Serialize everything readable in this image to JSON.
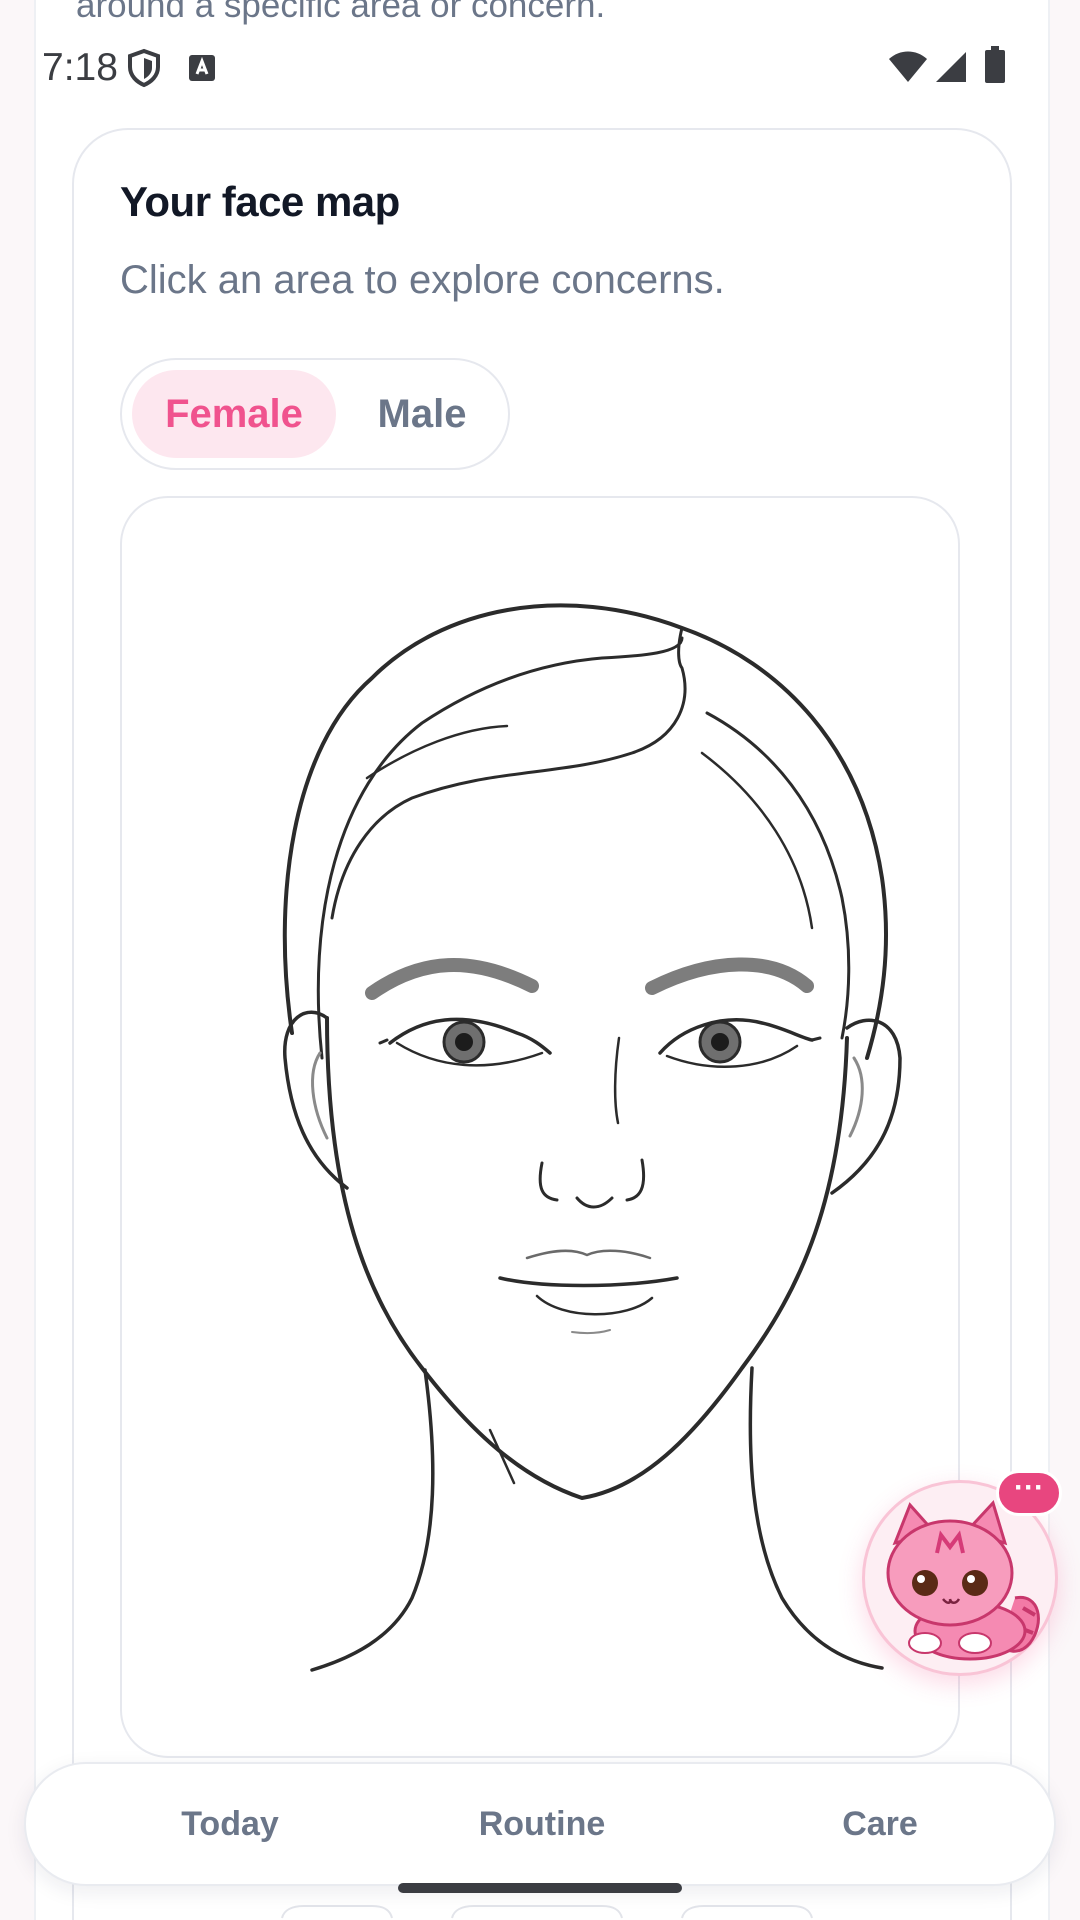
{
  "status_bar": {
    "time": "7:18",
    "icons": [
      "shield-icon",
      "keyboard-a-icon",
      "wifi-icon",
      "signal-icon",
      "battery-icon"
    ]
  },
  "clipped_text": "around a specific area or concern.",
  "face_map": {
    "title": "Your face map",
    "subtitle": "Click an area to explore concerns.",
    "gender_toggle": {
      "options": [
        "Female",
        "Male"
      ],
      "selected": "Female"
    },
    "illustration": "female-face-line-drawing"
  },
  "assistant": {
    "mascot": "pink-pixel-cat",
    "bubble_label": "···"
  },
  "bottom_nav": {
    "items": [
      {
        "label": "Today"
      },
      {
        "label": "Routine"
      },
      {
        "label": "Care"
      }
    ]
  },
  "colors": {
    "accent": "#f0538e",
    "accent_bg": "#fde7ef",
    "text_primary": "#121826",
    "text_muted": "#6b7689",
    "border": "#e6e8ee"
  }
}
